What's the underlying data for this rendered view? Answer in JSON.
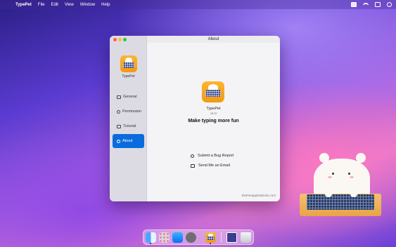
{
  "menubar": {
    "apple_glyph": "",
    "app_name": "TypePet",
    "menus": [
      "File",
      "Edit",
      "View",
      "Window",
      "Help"
    ],
    "status_icons": [
      "keyboard-badge-icon",
      "wifi-icon",
      "control-center-icon",
      "user-icon"
    ]
  },
  "window": {
    "title": "About",
    "sidebar": {
      "app_name": "TypePet",
      "items": [
        {
          "label": "General",
          "icon": "window-icon",
          "active": false
        },
        {
          "label": "Permission",
          "icon": "permission-icon",
          "active": false
        },
        {
          "label": "Tutorial",
          "icon": "tutorial-icon",
          "active": false
        },
        {
          "label": "About",
          "icon": "info-icon",
          "active": true
        }
      ]
    },
    "about": {
      "app_name": "TypePet",
      "version": "v1.0",
      "tagline": "Make typing more fun",
      "links": [
        {
          "label": "Submit a Bug Report",
          "icon": "bug-icon"
        },
        {
          "label": "Send Me an Email",
          "icon": "mail-icon"
        }
      ],
      "footer": "thefreeappthattools.com"
    }
  },
  "dock": {
    "apps": [
      "finder-icon",
      "launchpad-icon",
      "app-store-icon",
      "system-settings-icon",
      "typepet-icon",
      "minimized-window-icon",
      "trash-icon"
    ]
  },
  "colors": {
    "accent": "#0a6cdc",
    "logo_orange": "#f29a12",
    "sidebar_bg": "#dcdbe3",
    "content_bg": "#f4f4f6"
  }
}
